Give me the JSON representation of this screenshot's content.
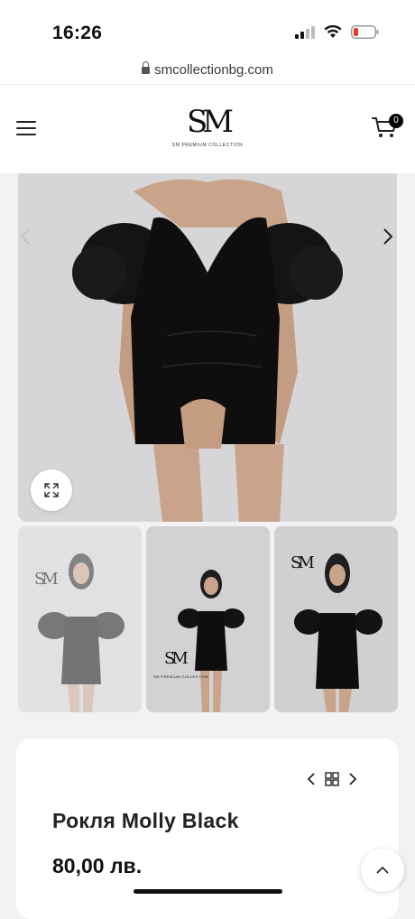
{
  "status_bar": {
    "time": "16:26"
  },
  "browser": {
    "url": "smcollectionbg.com"
  },
  "header": {
    "logo_mark": "SM",
    "logo_sub": "SM PREMIUM COLLECTION",
    "cart_count": "0"
  },
  "gallery": {
    "thumb_logo_sub": "SM PREMIUM COLLECTION"
  },
  "product": {
    "title": "Рокля Molly Black",
    "price": "80,00 лв."
  },
  "colors": {
    "accent": "#000000",
    "card_bg": "#ffffff",
    "gallery_bg": "#d8d8da"
  }
}
